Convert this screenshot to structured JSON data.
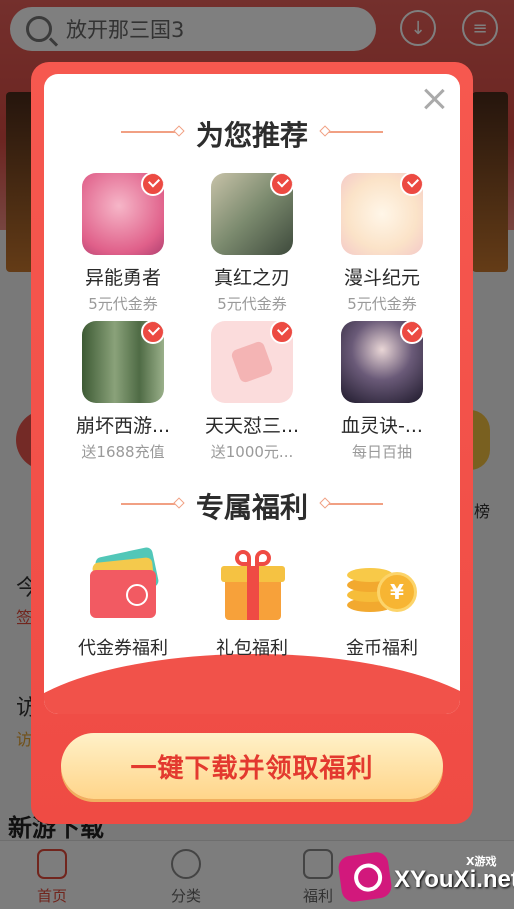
{
  "background": {
    "search_text": "放开那三国3",
    "side_texts": [
      "今",
      "签",
      "访",
      "访"
    ],
    "right_texts": [
      "榜"
    ],
    "new_games_heading": "新游下载",
    "tabs": [
      {
        "label": "首页",
        "active": true
      },
      {
        "label": "分类",
        "active": false
      },
      {
        "label": "福利",
        "active": false
      }
    ]
  },
  "modal": {
    "recommend_title": "为您推荐",
    "games": [
      {
        "name": "异能勇者",
        "sub": "5元代金券",
        "color": "#f08aa8",
        "checked": true
      },
      {
        "name": "真红之刃",
        "sub": "5元代金券",
        "color": "#7e8f7a",
        "checked": true
      },
      {
        "name": "漫斗纪元",
        "sub": "5元代金券",
        "color": "#fbe7cf",
        "checked": true
      },
      {
        "name": "崩坏西游...",
        "sub": "送1688充值",
        "color": "#5f7a55",
        "checked": true
      },
      {
        "name": "天天怼三...",
        "sub": "送1000元...",
        "color": "#fbdada",
        "checked": true
      },
      {
        "name": "血灵诀-...",
        "sub": "每日百抽",
        "color": "#2a2436",
        "checked": true
      }
    ],
    "perks_title": "专属福利",
    "perks": [
      {
        "label": "代金券福利",
        "icon": "voucher-icon"
      },
      {
        "label": "礼包福利",
        "icon": "gift-box-icon"
      },
      {
        "label": "金币福利",
        "icon": "gold-coins-icon"
      }
    ],
    "cta_label": "一键下载并领取福利"
  },
  "watermark": {
    "small": "X游戏",
    "big": "XYouXi.net"
  },
  "colors": {
    "accent": "#ef4b44",
    "cta_text": "#e3392f"
  }
}
